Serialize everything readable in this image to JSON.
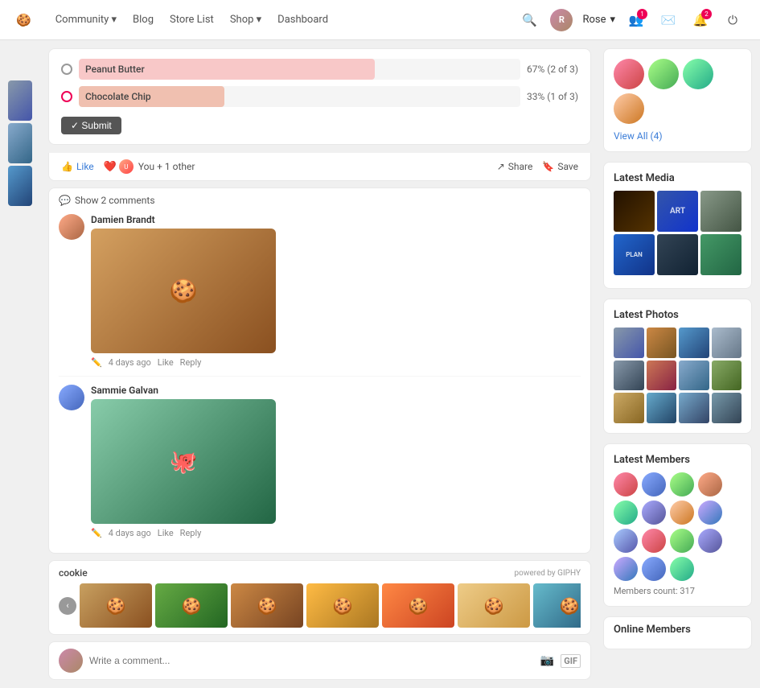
{
  "navbar": {
    "links": [
      {
        "label": "Community ▾",
        "key": "community"
      },
      {
        "label": "Blog",
        "key": "blog"
      },
      {
        "label": "Store List",
        "key": "store-list"
      },
      {
        "label": "Shop ▾",
        "key": "shop"
      },
      {
        "label": "Dashboard",
        "key": "dashboard"
      }
    ],
    "user": "Rose",
    "user_chevron": "▾"
  },
  "poll": {
    "options": [
      {
        "label": "Peanut Butter",
        "pct": "67%",
        "detail": "(2 of 3)",
        "fill_class": "peanut"
      },
      {
        "label": "Chocolate Chip",
        "pct": "33%",
        "detail": "(1 of 3)",
        "fill_class": "choc"
      }
    ],
    "submit_label": "✓ Submit"
  },
  "reactions": {
    "like_label": "Like",
    "heart_label": "You + 1 other",
    "share_label": "Share",
    "save_label": "Save"
  },
  "comments": {
    "show_label": "Show 2 comments",
    "items": [
      {
        "author": "Damien Brandt",
        "time": "4 days ago",
        "like_label": "Like",
        "reply_label": "Reply"
      },
      {
        "author": "Sammie Galvan",
        "time": "4 days ago",
        "like_label": "Like",
        "reply_label": "Reply"
      }
    ]
  },
  "gif_search": {
    "term": "cookie",
    "powered_by": "powered by GIPHY",
    "prev": "‹",
    "next": "›"
  },
  "write_comment": {
    "placeholder": "Write a comment..."
  },
  "sidebar": {
    "view_all": "View All (4)",
    "latest_media_title": "Latest Media",
    "latest_photos_title": "Latest Photos",
    "latest_members_title": "Latest Members",
    "members_count": "Members count: 317",
    "online_members_title": "Online Members"
  }
}
